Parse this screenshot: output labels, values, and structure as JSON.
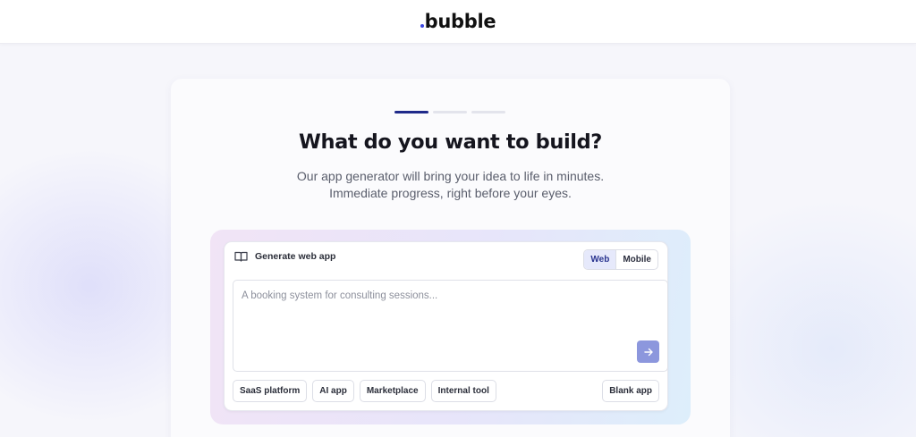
{
  "brand": {
    "name": "bubble",
    "accent": "#3b46e0"
  },
  "progress": {
    "total_steps": 3,
    "current_step": 1,
    "active_color": "#1f2a8a"
  },
  "hero": {
    "title": "What do you want to build?",
    "subtitle_line1": "Our app generator will bring your idea to life in minutes.",
    "subtitle_line2": "Immediate progress, right before your eyes."
  },
  "composer": {
    "label": "Generate web app",
    "label_icon": "book-open-icon",
    "platform_toggle": {
      "options": [
        "Web",
        "Mobile"
      ],
      "selected": "Web"
    },
    "prompt": {
      "value": "",
      "placeholder": "A booking system for consulting sessions..."
    },
    "submit_icon": "arrow-right-icon",
    "submit_color": "#8c97dd",
    "suggestions": [
      "SaaS platform",
      "AI app",
      "Marketplace",
      "Internal tool"
    ],
    "blank_app_label": "Blank app"
  }
}
